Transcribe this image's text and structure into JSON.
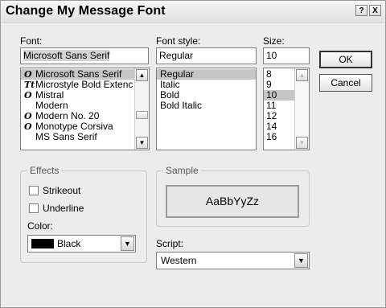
{
  "window": {
    "title": "Change My Message Font",
    "help_glyph": "?",
    "close_glyph": "X"
  },
  "font": {
    "label": "Font:",
    "value": "Microsoft Sans Serif",
    "items": [
      {
        "name": "Microsoft Sans Serif",
        "icon": "opentype-icon",
        "glyph": "O",
        "selected": true
      },
      {
        "name": "Microstyle Bold Extenc",
        "icon": "truetype-icon",
        "glyph": "Tt",
        "selected": false
      },
      {
        "name": "Mistral",
        "icon": "opentype-icon",
        "glyph": "O",
        "selected": false
      },
      {
        "name": "Modern",
        "icon": "",
        "glyph": "",
        "selected": false
      },
      {
        "name": "Modern No. 20",
        "icon": "opentype-icon",
        "glyph": "O",
        "selected": false
      },
      {
        "name": "Monotype Corsiva",
        "icon": "opentype-icon",
        "glyph": "O",
        "selected": false
      },
      {
        "name": "MS Sans Serif",
        "icon": "",
        "glyph": "",
        "selected": false
      }
    ]
  },
  "font_style": {
    "label": "Font style:",
    "value": "Regular",
    "items": [
      "Regular",
      "Italic",
      "Bold",
      "Bold Italic"
    ],
    "selected": "Regular"
  },
  "size": {
    "label": "Size:",
    "value": "10",
    "items": [
      "8",
      "9",
      "10",
      "11",
      "12",
      "14",
      "16"
    ],
    "selected": "10"
  },
  "buttons": {
    "ok": "OK",
    "cancel": "Cancel"
  },
  "effects": {
    "legend": "Effects",
    "strikeout_label": "Strikeout",
    "strikeout_checked": false,
    "underline_label": "Underline",
    "underline_checked": false,
    "color_label": "Color:",
    "color_value": "Black",
    "color_hex": "#000000"
  },
  "sample": {
    "legend": "Sample",
    "text": "AaBbYyZz"
  },
  "script": {
    "label": "Script:",
    "value": "Western"
  },
  "icons": {
    "scroll_up": "▲",
    "scroll_down": "▼",
    "dropdown": "▼"
  }
}
